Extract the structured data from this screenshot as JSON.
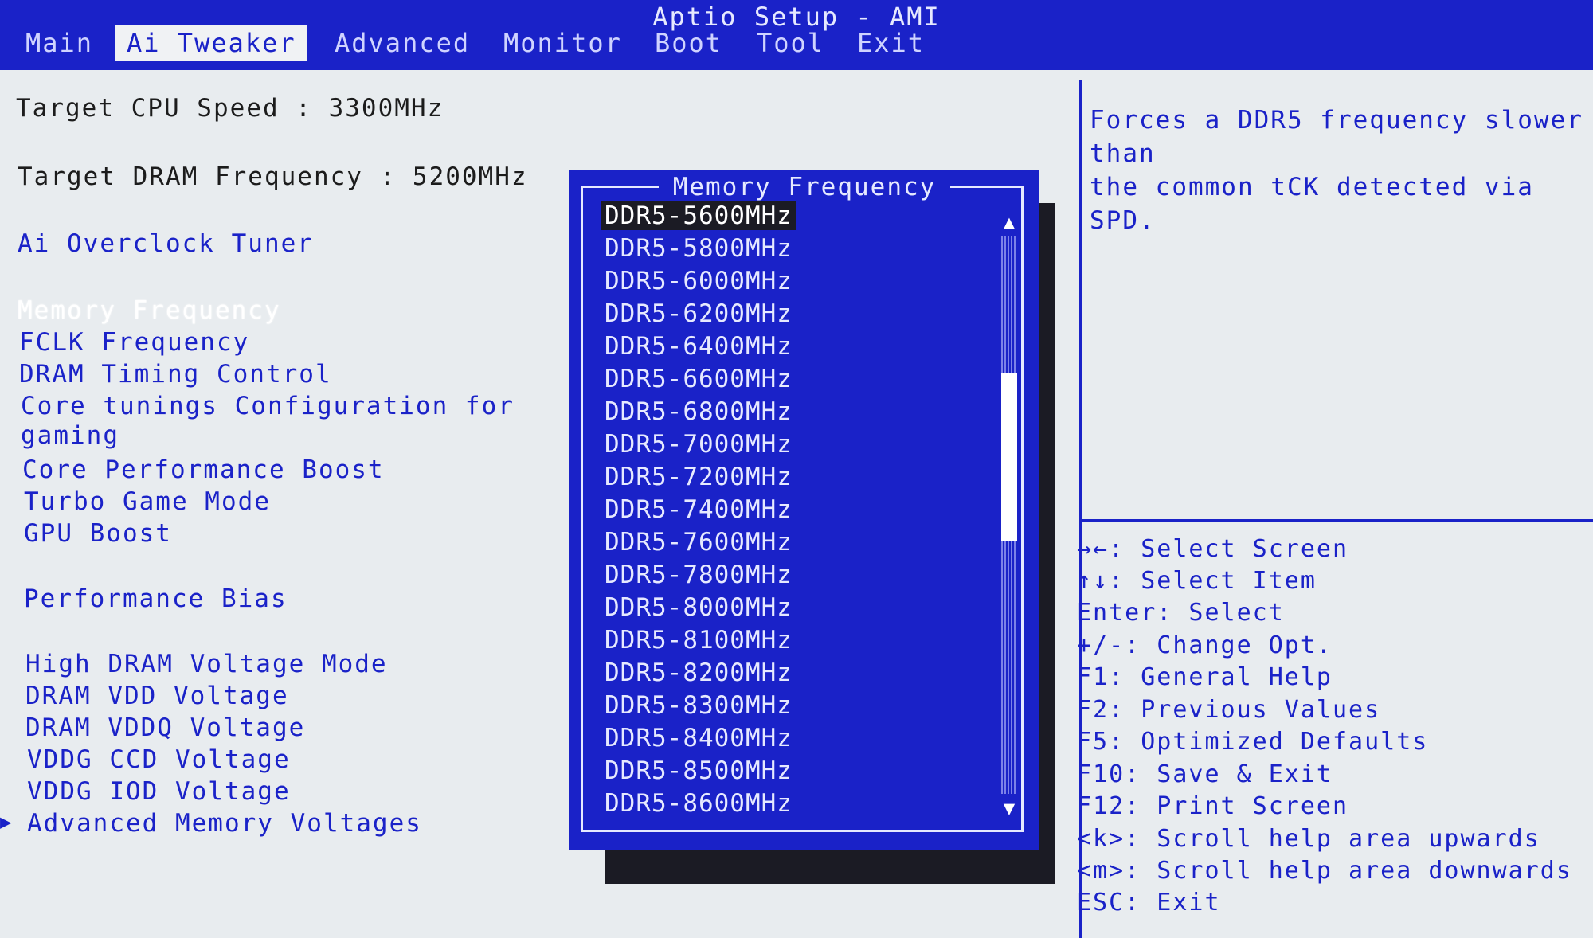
{
  "window": {
    "title": "Aptio Setup - AMI"
  },
  "tabs": [
    {
      "label": "Main"
    },
    {
      "label": "Ai Tweaker"
    },
    {
      "label": "Advanced"
    },
    {
      "label": "Monitor"
    },
    {
      "label": "Boot"
    },
    {
      "label": "Tool"
    },
    {
      "label": "Exit"
    }
  ],
  "active_tab": "Ai Tweaker",
  "left_panel": {
    "target_cpu": "Target CPU Speed : 3300MHz",
    "target_dram": "Target DRAM Frequency : 5200MHz",
    "items": [
      {
        "label": "Ai Overclock Tuner"
      },
      {
        "label": "Memory Frequency"
      },
      {
        "label": "FCLK Frequency"
      },
      {
        "label": "DRAM Timing Control"
      },
      {
        "label": "Core tunings Configuration for"
      },
      {
        "label": "gaming"
      },
      {
        "label": "Core Performance Boost"
      },
      {
        "label": "Turbo Game Mode"
      },
      {
        "label": "GPU Boost"
      },
      {
        "label": "Performance Bias"
      },
      {
        "label": "High DRAM Voltage Mode"
      },
      {
        "label": "DRAM VDD Voltage"
      },
      {
        "label": "DRAM VDDQ Voltage"
      },
      {
        "label": "VDDG CCD Voltage"
      },
      {
        "label": "VDDG IOD Voltage"
      },
      {
        "label": "Advanced Memory Voltages"
      }
    ]
  },
  "popup": {
    "title": "Memory Frequency",
    "selected": "DDR5-5600MHz",
    "options": [
      "DDR5-5600MHz",
      "DDR5-5800MHz",
      "DDR5-6000MHz",
      "DDR5-6200MHz",
      "DDR5-6400MHz",
      "DDR5-6600MHz",
      "DDR5-6800MHz",
      "DDR5-7000MHz",
      "DDR5-7200MHz",
      "DDR5-7400MHz",
      "DDR5-7600MHz",
      "DDR5-7800MHz",
      "DDR5-8000MHz",
      "DDR5-8100MHz",
      "DDR5-8200MHz",
      "DDR5-8300MHz",
      "DDR5-8400MHz",
      "DDR5-8500MHz",
      "DDR5-8600MHz"
    ]
  },
  "help": {
    "lines": [
      "Forces a DDR5 frequency slower",
      "than",
      "the common tCK detected via",
      "SPD."
    ]
  },
  "keys": [
    "→←: Select Screen",
    "↑↓: Select Item",
    "Enter: Select",
    "+/-: Change Opt.",
    "F1: General Help",
    "F2: Previous Values",
    "F5: Optimized Defaults",
    "F10: Save & Exit",
    "F12: Print Screen",
    "<k>: Scroll help area upwards",
    "<m>: Scroll help area downwards",
    "ESC: Exit"
  ],
  "icons": {
    "scroll_up": "triangle-up",
    "scroll_down": "triangle-down",
    "submenu": "triangle-right"
  },
  "colors": {
    "bios_blue": "#1a22c8",
    "background": "#e8ecef",
    "selection": "#1b1b24"
  }
}
